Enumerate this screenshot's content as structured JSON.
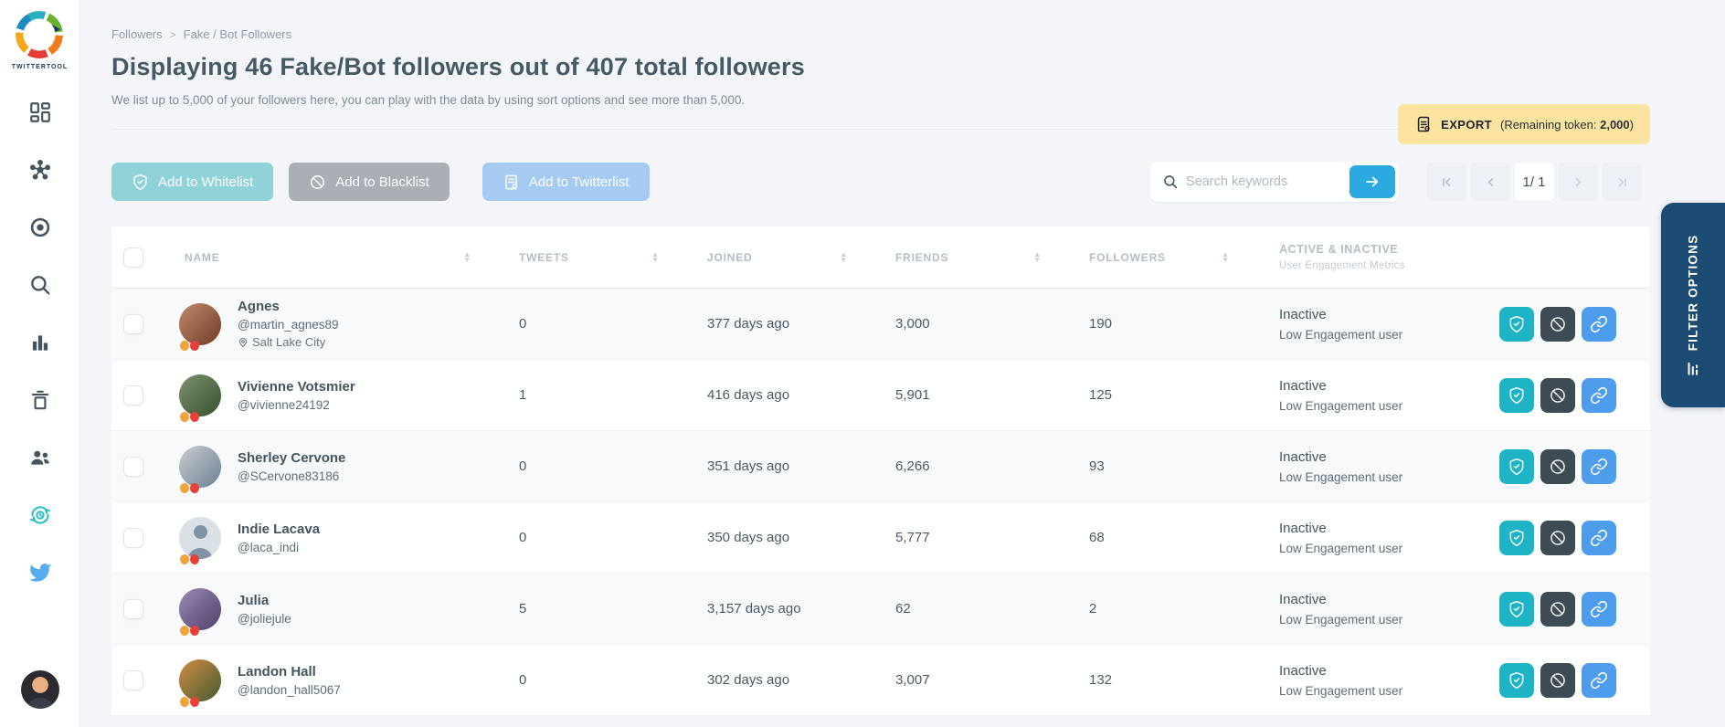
{
  "sidebar": {
    "brand": "TWITTERTOOL",
    "icons": [
      "dashboard-icon",
      "network-icon",
      "target-icon",
      "search-icon",
      "bar-chart-icon",
      "trash-icon",
      "users-icon",
      "refresh-clock-icon",
      "twitter-icon"
    ]
  },
  "breadcrumb": {
    "section": "Followers",
    "separator": ">",
    "page": "Fake / Bot Followers"
  },
  "header": {
    "title": "Displaying 46 Fake/Bot followers out of 407 total followers",
    "subtitle": "We list up to 5,000 of your followers here, you can play with the data by using sort options and see more than 5,000.",
    "export": {
      "label": "EXPORT",
      "note_prefix": "(Remaining token: ",
      "token": "2,000",
      "note_suffix": ")"
    }
  },
  "toolbar": {
    "whitelist_label": "Add to Whitelist",
    "blacklist_label": "Add to Blacklist",
    "twitterlist_label": "Add to Twitterlist",
    "search_placeholder": "Search keywords",
    "pagination": {
      "display": "1/ 1"
    }
  },
  "filter_tab": {
    "label": "FILTER OPTIONS"
  },
  "table": {
    "columns": [
      "NAME",
      "TWEETS",
      "JOINED",
      "FRIENDS",
      "FOLLOWERS"
    ],
    "engagement_header": {
      "title": "ACTIVE & INACTIVE",
      "subtitle": "User Engagement Metrics"
    },
    "rows": [
      {
        "name": "Agnes",
        "handle": "@martin_agnes89",
        "location": "Salt Lake City",
        "tweets": "0",
        "joined": "377 days ago",
        "friends": "3,000",
        "followers": "190",
        "status": "Inactive",
        "status_sub": "Low Engagement user",
        "avatar_type": "photo",
        "avatar_colors": [
          "#C08A6A",
          "#6F3B28"
        ]
      },
      {
        "name": "Vivienne Votsmier",
        "handle": "@vivienne24192",
        "location": "",
        "tweets": "1",
        "joined": "416 days ago",
        "friends": "5,901",
        "followers": "125",
        "status": "Inactive",
        "status_sub": "Low Engagement user",
        "avatar_type": "photo",
        "avatar_colors": [
          "#7B946A",
          "#39512F"
        ]
      },
      {
        "name": "Sherley Cervone",
        "handle": "@SCervone83186",
        "location": "",
        "tweets": "0",
        "joined": "351 days ago",
        "friends": "6,266",
        "followers": "93",
        "status": "Inactive",
        "status_sub": "Low Engagement user",
        "avatar_type": "photo",
        "avatar_colors": [
          "#C9CDD1",
          "#6C7F92"
        ]
      },
      {
        "name": "Indie Lacava",
        "handle": "@laca_indi",
        "location": "",
        "tweets": "0",
        "joined": "350 days ago",
        "friends": "5,777",
        "followers": "68",
        "status": "Inactive",
        "status_sub": "Low Engagement user",
        "avatar_type": "default",
        "avatar_colors": [
          "#D9E0E6",
          "#7E93A3"
        ]
      },
      {
        "name": "Julia",
        "handle": "@joliejule",
        "location": "",
        "tweets": "5",
        "joined": "3,157 days ago",
        "friends": "62",
        "followers": "2",
        "status": "Inactive",
        "status_sub": "Low Engagement user",
        "avatar_type": "photo",
        "avatar_colors": [
          "#9B8AB5",
          "#4E4169"
        ]
      },
      {
        "name": "Landon Hall",
        "handle": "@landon_hall5067",
        "location": "",
        "tweets": "0",
        "joined": "302 days ago",
        "friends": "3,007",
        "followers": "132",
        "status": "Inactive",
        "status_sub": "Low Engagement user",
        "avatar_type": "photo",
        "avatar_colors": [
          "#D08B43",
          "#465C33"
        ]
      }
    ]
  },
  "colors": {
    "page_bg": "#F3F5F9",
    "whitelist_btn": "#8FD3D9",
    "blacklist_btn": "#A9AFB4",
    "twitterlist_btn": "#A6CBF2",
    "export_bg": "#FBE3A0",
    "search_arrow_btn": "#2BA9E1",
    "filter_tab_bg": "#1C4B73",
    "action_whitelist": "#1FB4C5",
    "action_block": "#3D4B54",
    "action_link": "#4E9CEC",
    "dot_orange": "#F0A43C",
    "dot_red": "#E6403A",
    "brand_navy": "#16395B",
    "icon_slate": "#44555F",
    "icon_teal": "#2BBFC4",
    "icon_twitter": "#55ACEE"
  }
}
